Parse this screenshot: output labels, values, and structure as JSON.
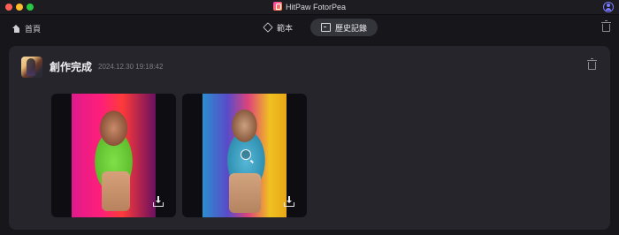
{
  "window": {
    "app_title": "HitPaw FotorPea"
  },
  "toolbar": {
    "home_label": "首頁",
    "tabs": [
      {
        "label": "範本",
        "icon": "cube-icon",
        "active": false
      },
      {
        "label": "歷史記錄",
        "icon": "history-icon",
        "active": true
      }
    ]
  },
  "card": {
    "title": "創作完成",
    "timestamp": "2024.12.30 19:18:42",
    "images": [
      {
        "name": "generated-image-1"
      },
      {
        "name": "generated-image-2"
      }
    ]
  },
  "colors": {
    "background": "#16161b",
    "card": "#25252b",
    "active_tab": "#34343b",
    "accent": "#7a7cff"
  }
}
